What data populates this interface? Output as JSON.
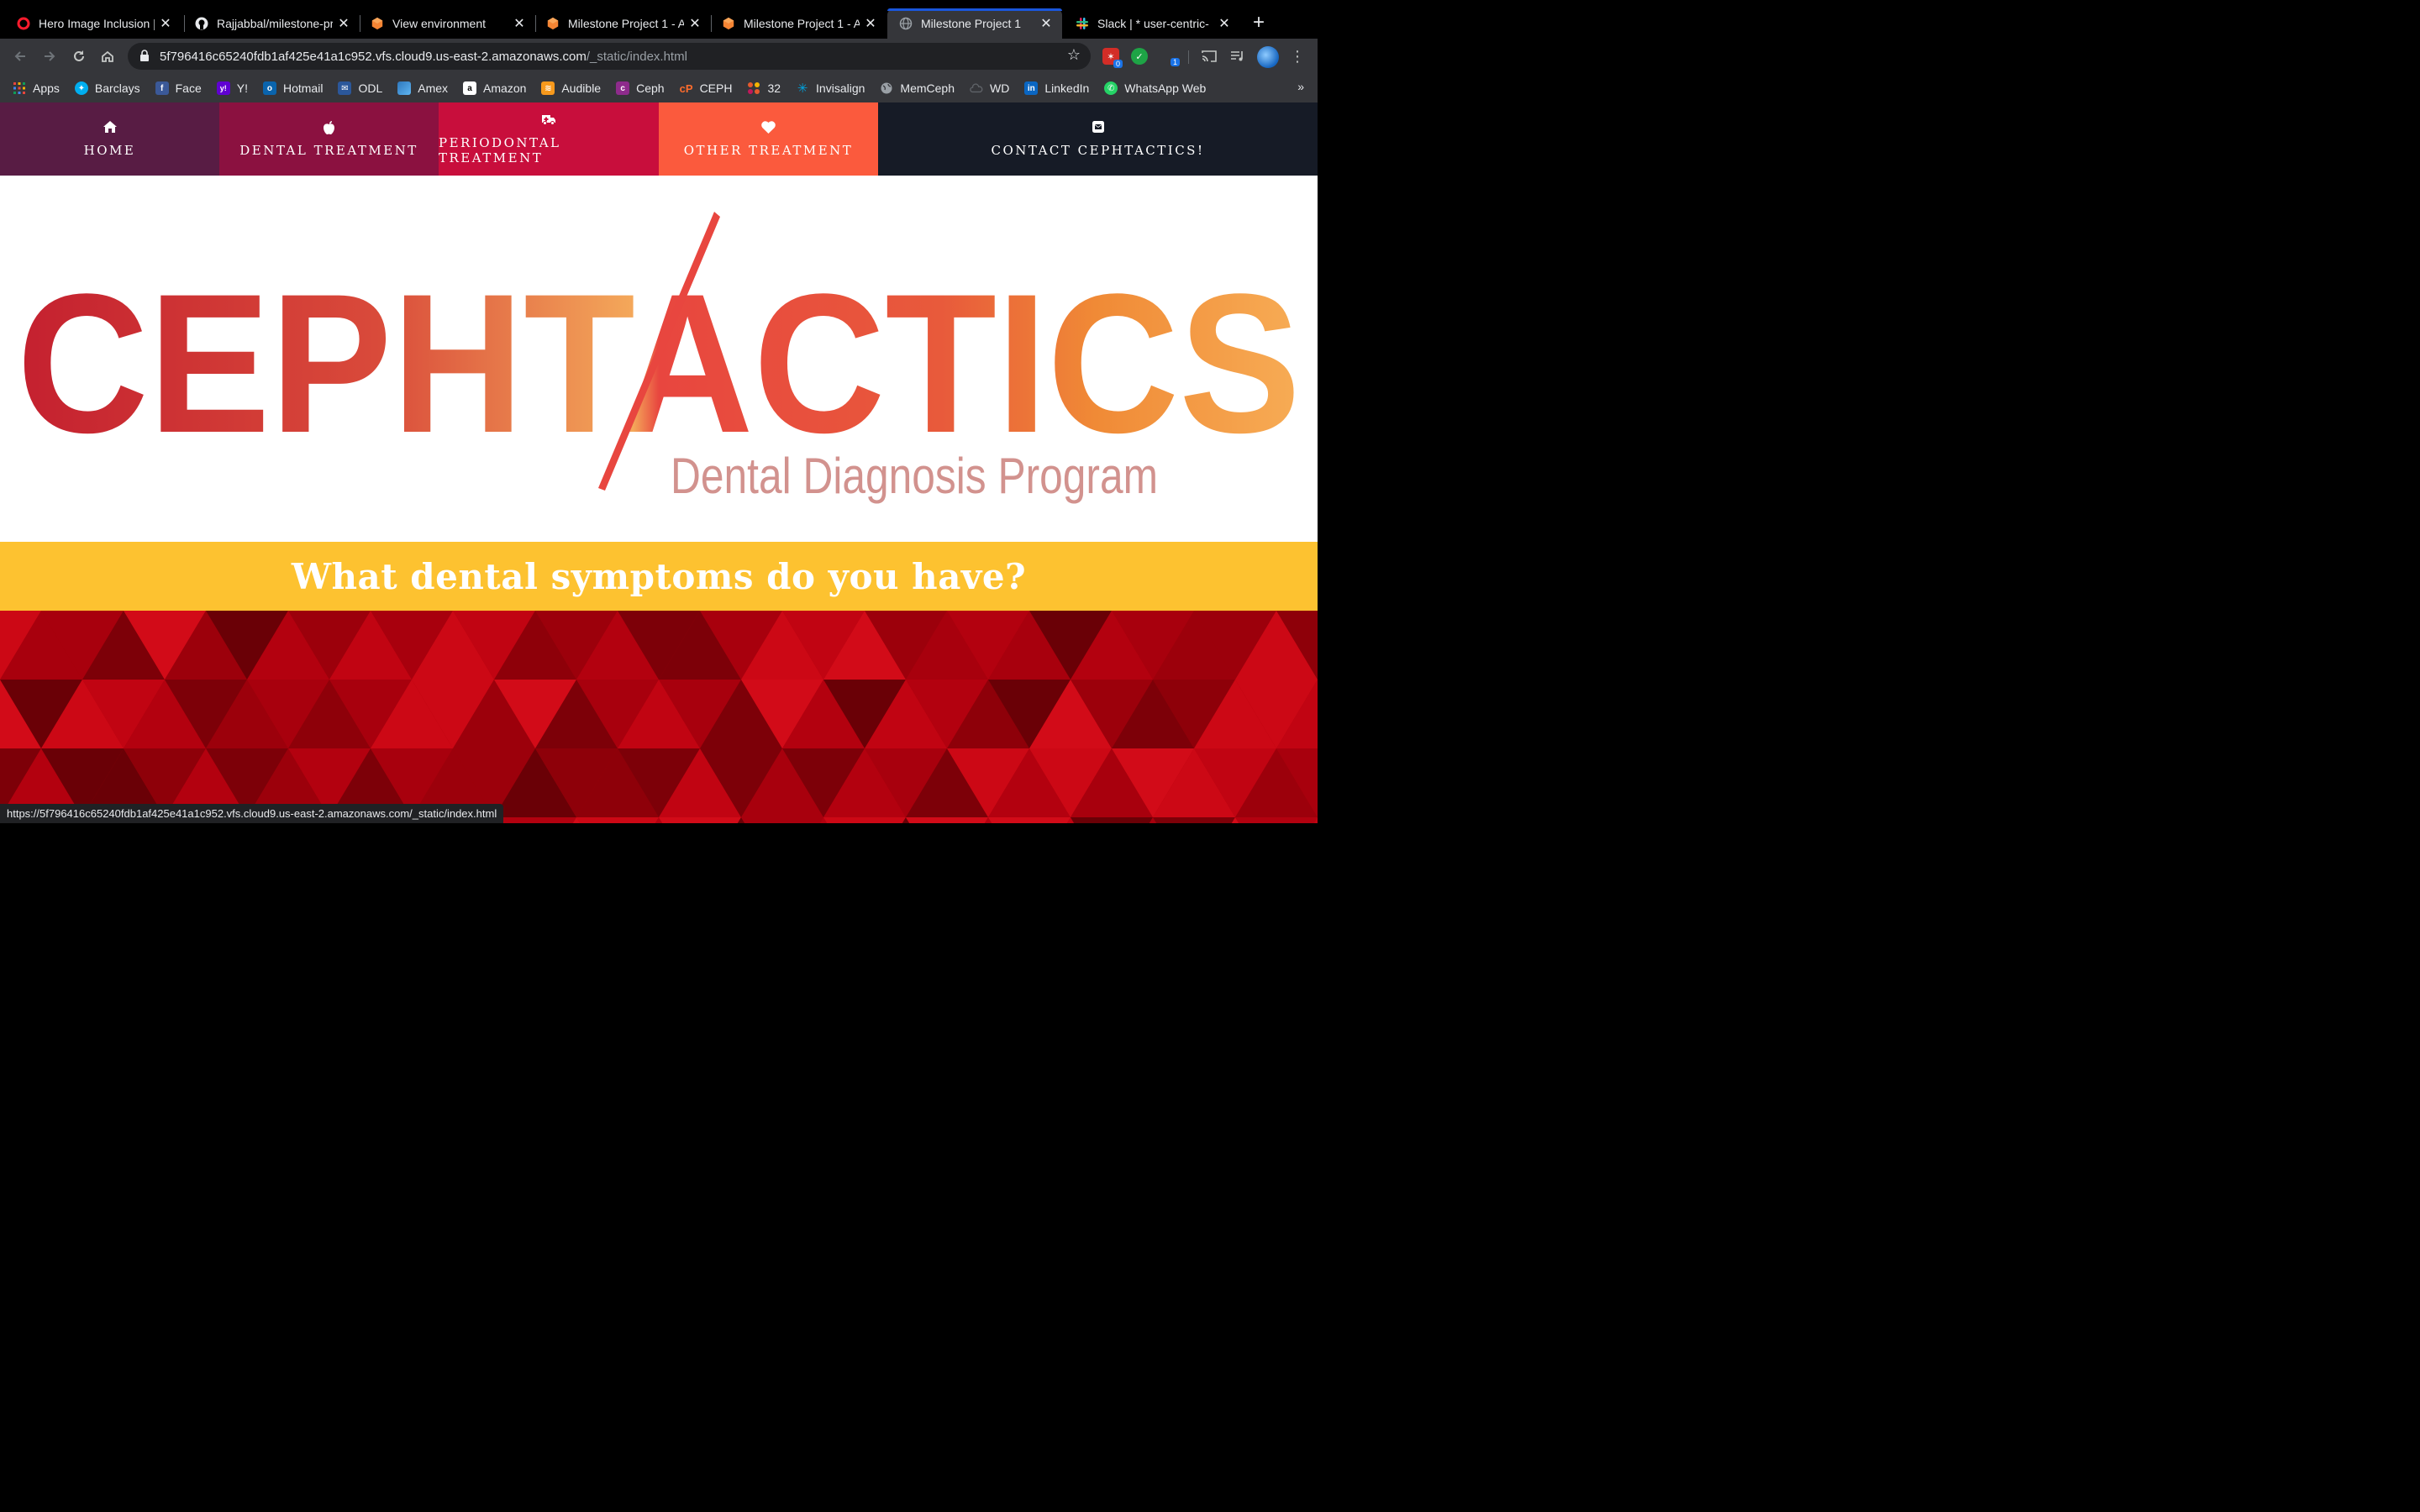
{
  "browser": {
    "tabs": [
      {
        "title": "Hero Image Inclusion |",
        "icon": "opera-icon"
      },
      {
        "title": "Rajjabbal/milestone-pr",
        "icon": "github-icon"
      },
      {
        "title": "View environment",
        "icon": "aws-cube-icon"
      },
      {
        "title": "Milestone Project 1 - A",
        "icon": "aws-cube-icon"
      },
      {
        "title": "Milestone Project 1 - A",
        "icon": "aws-cube-icon"
      },
      {
        "title": "Milestone Project 1",
        "icon": "globe-icon",
        "active": true
      },
      {
        "title": "Slack | * user-centric-",
        "icon": "slack-icon"
      }
    ],
    "url_host": "5f796416c65240fdb1af425e41a1c952.vfs.cloud9.us-east-2.amazonaws.com",
    "url_path": "/_static/index.html",
    "extension_badges": {
      "lastpass": "0",
      "tabs": "1"
    },
    "bookmarks": [
      {
        "label": "Apps",
        "icon": "apps-grid-icon",
        "color": "#e8453c"
      },
      {
        "label": "Barclays",
        "icon": "eagle-icon",
        "color": "#00aeef"
      },
      {
        "label": "Face",
        "icon": "facebook-icon",
        "color": "#3b5998"
      },
      {
        "label": "Y!",
        "icon": "yahoo-icon",
        "color": "#6001d2"
      },
      {
        "label": "Hotmail",
        "icon": "outlook-icon",
        "color": "#0a64ad"
      },
      {
        "label": "ODL",
        "icon": "mail-icon",
        "color": "#2b579a"
      },
      {
        "label": "Amex",
        "icon": "amex-icon",
        "color": "#2e77bc"
      },
      {
        "label": "Amazon",
        "icon": "amazon-icon",
        "color": "#ffffff"
      },
      {
        "label": "Audible",
        "icon": "audible-icon",
        "color": "#f7991c"
      },
      {
        "label": "Ceph",
        "icon": "ceph-icon",
        "color": "#8e2b8c"
      },
      {
        "label": "CEPH",
        "icon": "cpanel-icon",
        "color": "#ff6c2c"
      },
      {
        "label": "32",
        "icon": "puzzle-icon",
        "color": "#e65a2c"
      },
      {
        "label": "Invisalign",
        "icon": "star-burst-icon",
        "color": "#00a3e0"
      },
      {
        "label": "MemCeph",
        "icon": "globe-icon",
        "color": "#9aa0a6"
      },
      {
        "label": "WD",
        "icon": "cloud-icon",
        "color": "#5f6368"
      },
      {
        "label": "LinkedIn",
        "icon": "linkedin-icon",
        "color": "#0a66c2"
      },
      {
        "label": "WhatsApp Web",
        "icon": "whatsapp-icon",
        "color": "#25d366"
      }
    ],
    "status_url": "https://5f796416c65240fdb1af425e41a1c952.vfs.cloud9.us-east-2.amazonaws.com/_static/index.html"
  },
  "site": {
    "nav": [
      {
        "label": "HOME",
        "icon": "home-icon"
      },
      {
        "label": "DENTAL TREATMENT",
        "icon": "apple-icon"
      },
      {
        "label": "PERIODONTAL TREATMENT",
        "icon": "ambulance-icon"
      },
      {
        "label": "OTHER TREATMENT",
        "icon": "heart-icon"
      },
      {
        "label": "CONTACT CEPHTACTICS!",
        "icon": "envelope-icon"
      }
    ],
    "logo": {
      "wordmark": "CEPHTACTICS",
      "tagline": "Dental Diagnosis Program"
    },
    "banner_heading": "What dental symptoms do you have?",
    "colors": {
      "banner": "#fdc230",
      "pattern_base": "#a4000c",
      "logo_start": "#c4202f",
      "logo_end": "#f7ac55",
      "tagline": "#d2928e"
    }
  }
}
